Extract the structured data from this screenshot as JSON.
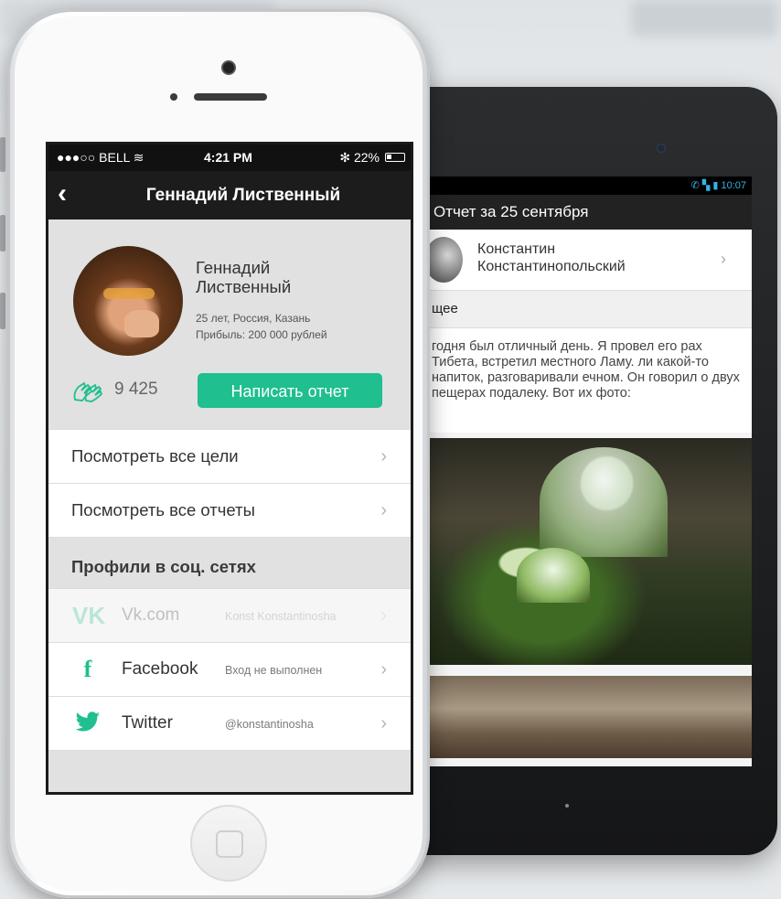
{
  "phone": {
    "status": {
      "carrier": "●●●○○ BELL",
      "time": "4:21 PM",
      "battery": "22%"
    },
    "nav": {
      "title": "Геннадий Лиственный"
    },
    "profile": {
      "name_line1": "Геннадий",
      "name_line2": "Лиственный",
      "info_line1": "25 лет, Россия, Казань",
      "info_line2": "Прибыль: 200 000 рублей",
      "likes": "9 425",
      "write_button": "Написать отчет"
    },
    "menu": [
      {
        "label": "Посмотреть все цели"
      },
      {
        "label": "Посмотреть все отчеты"
      }
    ],
    "social_header": "Профили в соц. сетях",
    "social": [
      {
        "name": "Vk.com",
        "sub": "Konst Konstantinosha",
        "icon": "vk-icon",
        "dimmed": true
      },
      {
        "name": "Facebook",
        "sub": "Вход не выполнен",
        "icon": "facebook-icon",
        "dimmed": false
      },
      {
        "name": "Twitter",
        "sub": "@konstantinosha",
        "icon": "twitter-icon",
        "dimmed": false
      }
    ]
  },
  "tablet": {
    "status_time": "10:07",
    "actionbar_title": "Отчет за 25 сентября",
    "user_line1": "Константин",
    "user_line2": "Константинопольский",
    "section": "щее",
    "report_text": "годня был отличный день. Я провел его рах Тибета, встретил местного Ламу. ли какой-то напиток, разговаривали ечном. Он говорил о двух пещерах подалеку. Вот их фото:"
  },
  "colors": {
    "accent": "#1fbf8f",
    "navbar": "#1c1c1c",
    "android_status": "#33b5e5"
  }
}
